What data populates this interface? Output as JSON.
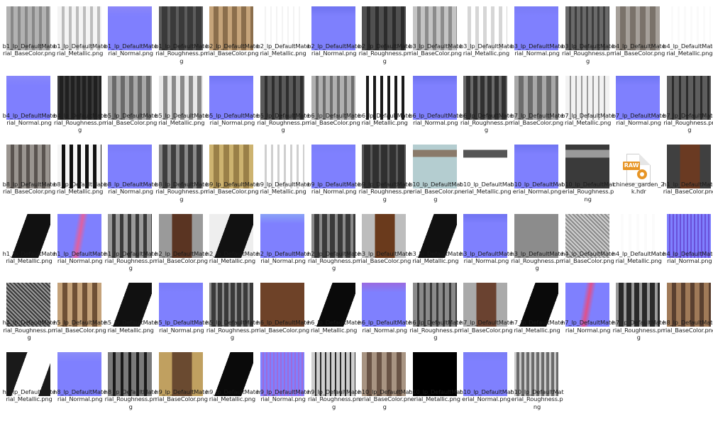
{
  "files": [
    {
      "name": "b1_lp_DefaultMaterial_BaseColor.png",
      "kind": "basecolor",
      "c1": "#b2b2b2",
      "c2": "#888888"
    },
    {
      "name": "b1_lp_DefaultMaterial_Metallic.png",
      "kind": "metallic",
      "c1": "#f4f4f4",
      "c2": "#bcbcbc"
    },
    {
      "name": "b1_lp_DefaultMaterial_Normal.png",
      "kind": "normal",
      "c1": "#7f7ffe",
      "c2": "#8a86f8"
    },
    {
      "name": "b1_lp_DefaultMaterial_Roughness.png",
      "kind": "roughness",
      "c1": "#5c5c5c",
      "c2": "#3a3a3a"
    },
    {
      "name": "b2_lp_DefaultMaterial_BaseColor.png",
      "kind": "basecolor",
      "c1": "#c6a47a",
      "c2": "#8b6e4c"
    },
    {
      "name": "b2_lp_DefaultMaterial_Metallic.png",
      "kind": "metallic",
      "c1": "#ffffff",
      "c2": "#f3f3f3"
    },
    {
      "name": "b2_lp_DefaultMaterial_Normal.png",
      "kind": "normal",
      "c1": "#7e80fd",
      "c2": "#6f73f0"
    },
    {
      "name": "b2_lp_DefaultMaterial_Roughness.png",
      "kind": "roughness",
      "c1": "#505050",
      "c2": "#2c2c2c"
    },
    {
      "name": "b3_lp_DefaultMaterial_BaseColor.png",
      "kind": "basecolor",
      "c1": "#c4c4c4",
      "c2": "#8c8c8c"
    },
    {
      "name": "b3_lp_DefaultMaterial_Metallic.png",
      "kind": "metallic",
      "c1": "#ffffff",
      "c2": "#d6d6d6"
    },
    {
      "name": "b3_lp_DefaultMaterial_Normal.png",
      "kind": "normal",
      "c1": "#7f80fe",
      "c2": "#7a7cf6"
    },
    {
      "name": "b3_lp_DefaultMaterial_Roughness.png",
      "kind": "roughness",
      "c1": "#6a6a6a",
      "c2": "#3e3e3e"
    },
    {
      "name": "b4_lp_DefaultMaterial_BaseColor.png",
      "kind": "basecolor",
      "c1": "#a6a09a",
      "c2": "#7a726a"
    },
    {
      "name": "b4_lp_DefaultMaterial_Metallic.png",
      "kind": "metallic",
      "c1": "#ffffff",
      "c2": "#fafafa"
    },
    {
      "name": "b4_lp_DefaultMaterial_Normal.png",
      "kind": "normal",
      "c1": "#7f7ffe",
      "c2": "#8787fa"
    },
    {
      "name": "b4_lp_DefaultMaterial_Roughness.png",
      "kind": "roughness",
      "c1": "#3a3a3a",
      "c2": "#202020"
    },
    {
      "name": "b5_lp_DefaultMaterial_BaseColor.png",
      "kind": "basecolor",
      "c1": "#a8a8a8",
      "c2": "#6a6a6a"
    },
    {
      "name": "b5_lp_DefaultMaterial_Metallic.png",
      "kind": "metallic",
      "c1": "#e8e8e8",
      "c2": "#8a8a8a"
    },
    {
      "name": "b5_lp_DefaultMaterial_Normal.png",
      "kind": "normal",
      "c1": "#7f80fe",
      "c2": "#7276f3"
    },
    {
      "name": "b5_lp_DefaultMaterial_Roughness.png",
      "kind": "roughness",
      "c1": "#5a5a5a",
      "c2": "#2e2e2e"
    },
    {
      "name": "b6_lp_DefaultMaterial_BaseColor.png",
      "kind": "basecolor",
      "c1": "#b0b0b0",
      "c2": "#6e6e6e"
    },
    {
      "name": "b6_lp_DefaultMaterial_Metallic.png",
      "kind": "metallic",
      "c1": "#ffffff",
      "c2": "#1a1a1a"
    },
    {
      "name": "b6_lp_DefaultMaterial_Normal.png",
      "kind": "normal",
      "c1": "#7f80fe",
      "c2": "#6e72ef"
    },
    {
      "name": "b6_lp_DefaultMaterial_Roughness.png",
      "kind": "roughness",
      "c1": "#6a6a6a",
      "c2": "#303030"
    },
    {
      "name": "b7_lp_DefaultMaterial_BaseColor.png",
      "kind": "basecolor",
      "c1": "#a8a8a8",
      "c2": "#6c6c6c"
    },
    {
      "name": "b7_lp_DefaultMaterial_Metallic.png",
      "kind": "metallic",
      "c1": "#f2f2f2",
      "c2": "#9a9a9a"
    },
    {
      "name": "b7_lp_DefaultMaterial_Normal.png",
      "kind": "normal",
      "c1": "#7f80fe",
      "c2": "#7076f2"
    },
    {
      "name": "b7_lp_DefaultMaterial_Roughness.png",
      "kind": "roughness",
      "c1": "#5e5e5e",
      "c2": "#2c2c2c"
    },
    {
      "name": "b8_lp_DefaultMaterial_BaseColor.png",
      "kind": "basecolor",
      "c1": "#9a9590",
      "c2": "#5a5450"
    },
    {
      "name": "b8_lp_DefaultMaterial_Metallic.png",
      "kind": "metallic",
      "c1": "#f6f6f6",
      "c2": "#111111"
    },
    {
      "name": "b8_lp_DefaultMaterial_Normal.png",
      "kind": "normal",
      "c1": "#7f80fe",
      "c2": "#7a7cf6"
    },
    {
      "name": "b8_lp_DefaultMaterial_Roughness.png",
      "kind": "roughness",
      "c1": "#8a8a8a",
      "c2": "#3e3e3e"
    },
    {
      "name": "b9_lp_DefaultMaterial_BaseColor.png",
      "kind": "basecolor",
      "c1": "#cdb370",
      "c2": "#9a8048"
    },
    {
      "name": "b9_lp_DefaultMaterial_Metallic.png",
      "kind": "metallic",
      "c1": "#ffffff",
      "c2": "#cfcfcf"
    },
    {
      "name": "b9_lp_DefaultMaterial_Normal.png",
      "kind": "normal",
      "c1": "#7f80fe",
      "c2": "#7a7ef8"
    },
    {
      "name": "b9_lp_DefaultMaterial_Roughness.png",
      "kind": "roughness",
      "c1": "#5a5a5a",
      "c2": "#303030"
    },
    {
      "name": "b10_lp_DefaultMaterial_BaseColor.png",
      "kind": "foliage",
      "c1": "#b4cdd0",
      "c2": "#8a7a6a"
    },
    {
      "name": "b10_lp_DefaultMaterial_Metallic.png",
      "kind": "foliage-white",
      "c1": "#ffffff",
      "c2": "#555555"
    },
    {
      "name": "b10_lp_DefaultMaterial_Normal.png",
      "kind": "normal",
      "c1": "#7f80fe",
      "c2": "#6f74f0"
    },
    {
      "name": "b10_lp_DefaultMaterial_Roughness.png",
      "kind": "foliage-dark",
      "c1": "#3a3a3a",
      "c2": "#9a9a9a"
    },
    {
      "name": "chinese_garden_2k.hdr",
      "kind": "raw-file",
      "c1": "#e79526",
      "c2": "#ffffff"
    },
    {
      "name": "h1_lp_DefaultMaterial_BaseColor.png",
      "kind": "brown-split",
      "c1": "#6a3a22",
      "c2": "#404040"
    },
    {
      "name": "h1_lp_DefaultMaterial_Metallic.png",
      "kind": "bw-split",
      "c1": "#111111",
      "c2": "#ffffff"
    },
    {
      "name": "h1_lp_DefaultMaterial_Normal.png",
      "kind": "normal-pink",
      "c1": "#7f80fe",
      "c2": "#e060a0"
    },
    {
      "name": "h1_lp_DefaultMaterial_Roughness.png",
      "kind": "roughness",
      "c1": "#9a9a9a",
      "c2": "#3a3a3a"
    },
    {
      "name": "h2_lp_DefaultMaterial_BaseColor.png",
      "kind": "brown-split",
      "c1": "#5a3422",
      "c2": "#9a9a9a"
    },
    {
      "name": "h2_lp_DefaultMaterial_Metallic.png",
      "kind": "bw-split",
      "c1": "#111111",
      "c2": "#eeeeee"
    },
    {
      "name": "h2_lp_DefaultMaterial_Normal.png",
      "kind": "normal",
      "c1": "#7f80fe",
      "c2": "#8aa2f6"
    },
    {
      "name": "h2_lp_DefaultMaterial_Roughness.png",
      "kind": "roughness",
      "c1": "#8a8a8a",
      "c2": "#3a3a3a"
    },
    {
      "name": "h3_lp_DefaultMaterial_BaseColor.png",
      "kind": "brown-split",
      "c1": "#6a3a1c",
      "c2": "#bdbdbd"
    },
    {
      "name": "h3_lp_DefaultMaterial_Metallic.png",
      "kind": "bw-split",
      "c1": "#111111",
      "c2": "#ffffff"
    },
    {
      "name": "h3_lp_DefaultMaterial_Normal.png",
      "kind": "normal",
      "c1": "#7f80fe",
      "c2": "#6f72f0"
    },
    {
      "name": "h3_lp_DefaultMaterial_Roughness.png",
      "kind": "roughness",
      "c1": "#8c8c8c",
      "c2": "#2a2a2a"
    },
    {
      "name": "h4_lp_DefaultMaterial_BaseColor.png",
      "kind": "noise",
      "c1": "#d0d0d0",
      "c2": "#8a8a8a"
    },
    {
      "name": "h4_lp_DefaultMaterial_Metallic.png",
      "kind": "metallic",
      "c1": "#ffffff",
      "c2": "#fbfbfb"
    },
    {
      "name": "h4_lp_DefaultMaterial_Normal.png",
      "kind": "normal-noise",
      "c1": "#7f80fe",
      "c2": "#6a50d8"
    },
    {
      "name": "h4_lp_DefaultMaterial_Roughness.png",
      "kind": "noise",
      "c1": "#9a9a9a",
      "c2": "#3a3a3a"
    },
    {
      "name": "h5_lp_DefaultMaterial_BaseColor.png",
      "kind": "basecolor",
      "c1": "#c4a27a",
      "c2": "#6e5036"
    },
    {
      "name": "h5_lp_DefaultMaterial_Metallic.png",
      "kind": "bw-split",
      "c1": "#111111",
      "c2": "#ffffff"
    },
    {
      "name": "h5_lp_DefaultMaterial_Normal.png",
      "kind": "normal",
      "c1": "#7f80fe",
      "c2": "#7a7cf6"
    },
    {
      "name": "h5_lp_DefaultMaterial_Roughness.png",
      "kind": "roughness",
      "c1": "#8a8a8a",
      "c2": "#3a3a3a"
    },
    {
      "name": "h6_lp_DefaultMaterial_BaseColor.png",
      "kind": "brown-split",
      "c1": "#6e4228",
      "c2": "#6e4228"
    },
    {
      "name": "h6_lp_DefaultMaterial_Metallic.png",
      "kind": "bw-split",
      "c1": "#0a0a0a",
      "c2": "#ffffff"
    },
    {
      "name": "h6_lp_DefaultMaterial_Normal.png",
      "kind": "normal",
      "c1": "#7f80fe",
      "c2": "#9a6ae0"
    },
    {
      "name": "h6_lp_DefaultMaterial_Roughness.png",
      "kind": "roughness",
      "c1": "#8a8a8a",
      "c2": "#3a3a3a"
    },
    {
      "name": "h7_lp_DefaultMaterial_BaseColor.png",
      "kind": "brown-split",
      "c1": "#6a4230",
      "c2": "#aaaaaa"
    },
    {
      "name": "h7_lp_DefaultMaterial_Metallic.png",
      "kind": "bw-split",
      "c1": "#0a0a0a",
      "c2": "#ffffff"
    },
    {
      "name": "h7_lp_DefaultMaterial_Normal.png",
      "kind": "normal-pink",
      "c1": "#7f80fe",
      "c2": "#e0508a"
    },
    {
      "name": "h7_lp_DefaultMaterial_Roughness.png",
      "kind": "roughness",
      "c1": "#9a9a9a",
      "c2": "#2a2a2a"
    },
    {
      "name": "h8_lp_DefaultMaterial_BaseColor.png",
      "kind": "basecolor",
      "c1": "#a07a58",
      "c2": "#5a4030"
    },
    {
      "name": "h8_lp_DefaultMaterial_Metallic.png",
      "kind": "bw-split",
      "c1": "#ffffff",
      "c2": "#1a1a1a"
    },
    {
      "name": "h8_lp_DefaultMaterial_Normal.png",
      "kind": "normal",
      "c1": "#7f80fe",
      "c2": "#8a8cf8"
    },
    {
      "name": "h8_lp_DefaultMaterial_Roughness.png",
      "kind": "roughness",
      "c1": "#7a7a7a",
      "c2": "#1a1a1a"
    },
    {
      "name": "h9_lp_DefaultMaterial_BaseColor.png",
      "kind": "brown-split",
      "c1": "#6a4a30",
      "c2": "#c0a060"
    },
    {
      "name": "h9_lp_DefaultMaterial_Metallic.png",
      "kind": "bw-split",
      "c1": "#0a0a0a",
      "c2": "#ffffff"
    },
    {
      "name": "h9_lp_DefaultMaterial_Normal.png",
      "kind": "normal-noise",
      "c1": "#7f80fe",
      "c2": "#a06ad8"
    },
    {
      "name": "h9_lp_DefaultMaterial_Roughness.png",
      "kind": "roughness",
      "c1": "#cfcfcf",
      "c2": "#2a2a2a"
    },
    {
      "name": "h10_lp_DefaultMaterial_BaseColor.png",
      "kind": "basecolor",
      "c1": "#a89482",
      "c2": "#6a5446"
    },
    {
      "name": "h10_lp_DefaultMaterial_Metallic.png",
      "kind": "solid",
      "c1": "#000000",
      "c2": "#000000"
    },
    {
      "name": "h10_lp_DefaultMaterial_Normal.png",
      "kind": "normal",
      "c1": "#7f80fe",
      "c2": "#7a7ef6"
    },
    {
      "name": "h10_lp_DefaultMaterial_Roughness.png",
      "kind": "roughness",
      "c1": "#c8c8c8",
      "c2": "#6a6a6a"
    }
  ]
}
